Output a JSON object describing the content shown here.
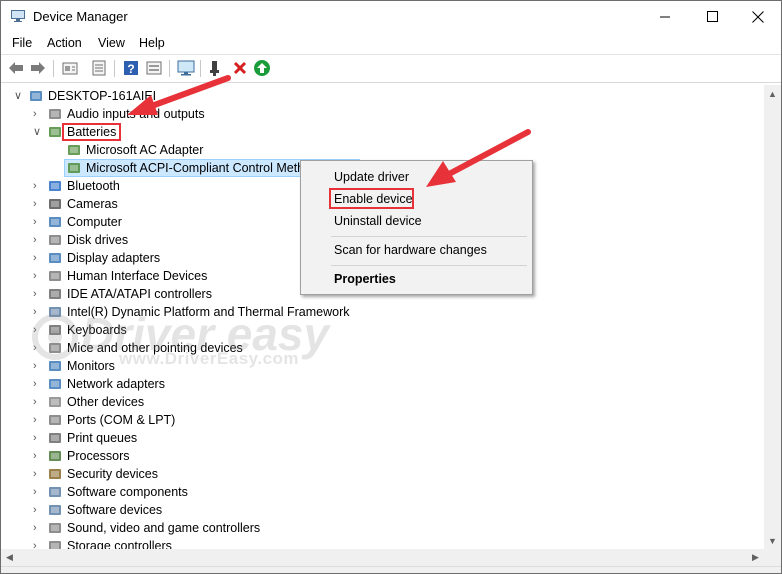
{
  "window": {
    "title": "Device Manager"
  },
  "menu": [
    "File",
    "Action",
    "View",
    "Help"
  ],
  "toolbar_icons": [
    "back-arrow-icon",
    "forward-arrow-icon",
    "device-view-icon",
    "properties-icon",
    "help-icon",
    "resource-view-icon",
    "monitor-icon",
    "update-driver-icon",
    "uninstall-x-icon",
    "enable-device-icon"
  ],
  "tree": {
    "root": "DESKTOP-161AIEI",
    "categories": [
      "Audio inputs and outputs",
      "Batteries",
      "Bluetooth",
      "Cameras",
      "Computer",
      "Disk drives",
      "Display adapters",
      "Human Interface Devices",
      "IDE ATA/ATAPI controllers",
      "Intel(R) Dynamic Platform and Thermal Framework",
      "Keyboards",
      "Mice and other pointing devices",
      "Monitors",
      "Network adapters",
      "Other devices",
      "Ports (COM & LPT)",
      "Print queues",
      "Processors",
      "Security devices",
      "Software components",
      "Software devices",
      "Sound, video and game controllers",
      "Storage controllers"
    ],
    "battery_children": [
      "Microsoft AC Adapter",
      "Microsoft ACPI-Compliant Control Meth"
    ]
  },
  "context_menu": {
    "items": [
      "Update driver",
      "Enable device",
      "Uninstall device",
      "Scan for hardware changes",
      "Properties"
    ]
  },
  "watermark": {
    "brand": "Driver easy",
    "url": "www.DriverEasy.com"
  },
  "colors": {
    "highlight_red": "#e8323a",
    "selection_blue": "#cce8ff",
    "green_enable": "#1a9c3a"
  }
}
